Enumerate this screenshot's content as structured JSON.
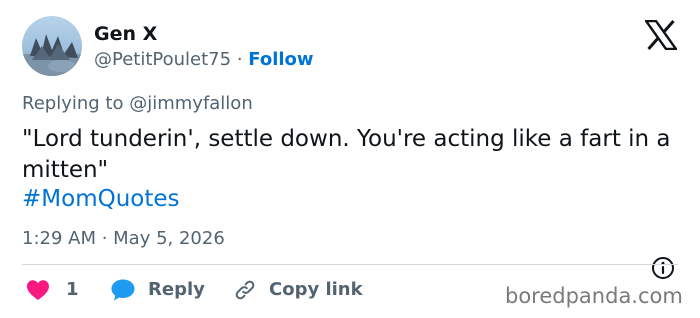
{
  "author": {
    "display_name": "Gen X",
    "handle": "@PetitPoulet75",
    "separator": "·",
    "follow_label": "Follow"
  },
  "reply_context": {
    "prefix": "Replying to",
    "mention": "@jimmyfallon"
  },
  "tweet": {
    "text": "\"Lord tunderin', settle down. You're acting like a fart in a mitten\"",
    "hashtag": "#MomQuotes",
    "timestamp": "1:29 AM · May 5, 2026"
  },
  "actions": {
    "like_count": "1",
    "reply_label": "Reply",
    "copy_link_label": "Copy link"
  },
  "watermark": "boredpanda.com",
  "icons": {
    "platform_logo": "x-logo-icon",
    "info": "info-icon",
    "like": "heart-icon",
    "reply": "speech-bubble-icon",
    "copy": "link-icon"
  },
  "colors": {
    "link_blue": "#0074d4",
    "heart_red": "#f91880",
    "reply_blue": "#1d9bf0",
    "secondary_text": "#536471",
    "primary_text": "#0f1419"
  }
}
